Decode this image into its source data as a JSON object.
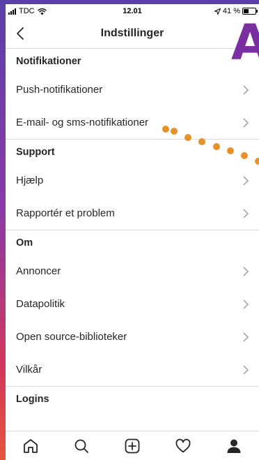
{
  "status_bar": {
    "carrier": "TDC",
    "time": "12.01",
    "battery": "41 %"
  },
  "nav": {
    "title": "Indstillinger",
    "back_icon": "chevron-left-icon"
  },
  "sections": [
    {
      "header": "Notifikationer",
      "items": [
        "Push-notifikationer",
        "E-mail- og sms-notifikationer"
      ]
    },
    {
      "header": "Support",
      "items": [
        "Hjælp",
        "Rapportér et problem"
      ]
    },
    {
      "header": "Om",
      "items": [
        "Annoncer",
        "Datapolitik",
        "Open source-biblioteker",
        "Vilkår"
      ]
    },
    {
      "header": "Logins",
      "items": []
    }
  ],
  "tabbar": {
    "icons": [
      "home-icon",
      "search-icon",
      "add-icon",
      "heart-icon",
      "profile-icon"
    ]
  },
  "annotation": {
    "badge_letter": "A",
    "color": "#7a2fa0",
    "dots_color": "#e6922a"
  }
}
